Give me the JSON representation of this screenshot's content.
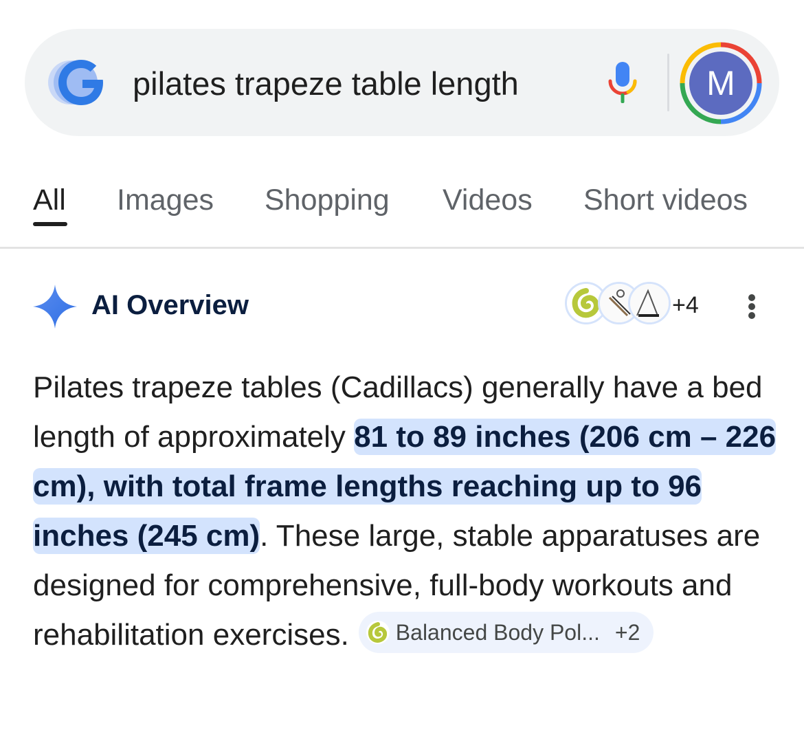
{
  "search": {
    "query": "pilates trapeze table length",
    "logo_icon": "google-g-icon",
    "mic_icon": "microphone-icon",
    "avatar_initial": "M"
  },
  "tabs": [
    {
      "label": "All",
      "active": true
    },
    {
      "label": "Images",
      "active": false
    },
    {
      "label": "Shopping",
      "active": false
    },
    {
      "label": "Videos",
      "active": false
    },
    {
      "label": "Short videos",
      "active": false
    }
  ],
  "ai_overview": {
    "title": "AI Overview",
    "sources_more": "+4",
    "menu_icon": "more-vert-icon",
    "text_before": "Pilates trapeze tables (Cadillacs) generally have a bed length of approximately ",
    "text_highlight": "81 to 89 inches (206 cm – 226 cm), with total frame lengths reaching up to 96 inches (245 cm)",
    "text_after": ". These large, stable apparatuses are designed for comprehensive, full-body workouts and rehabilitation exercises.",
    "citation": {
      "label": "Balanced Body Pol...",
      "more": "+2",
      "icon": "balanced-body-logo-icon"
    }
  },
  "colors": {
    "highlight_bg": "#d3e3fd",
    "highlight_text": "#0b1e3f",
    "sparkle": "#4285f4",
    "avatar_bg": "#5c6bc0",
    "search_bg": "#f1f3f4"
  }
}
